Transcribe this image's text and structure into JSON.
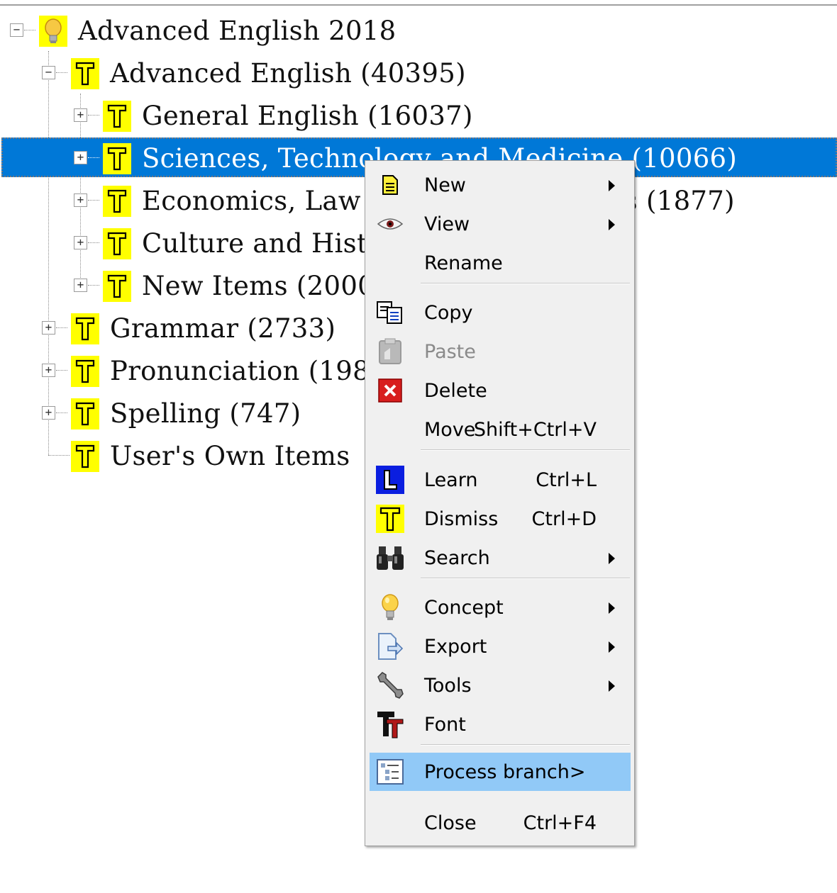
{
  "tree": {
    "root": {
      "label": "Advanced English 2018",
      "expander": "−"
    },
    "nodes": [
      {
        "label": "Advanced English (40395)",
        "expander": "−"
      },
      {
        "label": "General English (16037)",
        "expander": "+"
      },
      {
        "label": "Sciences, Technology and Medicine (10066)",
        "expander": "+"
      },
      {
        "label": "Economics, Law and Social Sciences (1877)",
        "expander": "+"
      },
      {
        "label": "Culture and History (10415)",
        "expander": "+"
      },
      {
        "label": "New Items (2000)",
        "expander": "+"
      },
      {
        "label": "Grammar (2733)",
        "expander": "+"
      },
      {
        "label": "Pronunciation (1981)",
        "expander": "+"
      },
      {
        "label": "Spelling (747)",
        "expander": "+"
      },
      {
        "label": "User's Own Items"
      }
    ]
  },
  "menu": {
    "items": [
      {
        "label": "New",
        "icon": "new-document-icon",
        "submenu": true
      },
      {
        "label": "View",
        "icon": "eye-icon",
        "submenu": true
      },
      {
        "label": "Rename"
      },
      {
        "label": "Copy",
        "icon": "copy-icon"
      },
      {
        "label": "Paste",
        "icon": "paste-icon",
        "disabled": true
      },
      {
        "label": "Delete",
        "icon": "delete-icon"
      },
      {
        "label": "Move",
        "shortcut": "Shift+Ctrl+V"
      },
      {
        "label": "Learn",
        "icon": "learn-icon",
        "shortcut": "Ctrl+L"
      },
      {
        "label": "Dismiss",
        "icon": "dismiss-icon",
        "shortcut": "Ctrl+D"
      },
      {
        "label": "Search",
        "icon": "binoculars-icon",
        "submenu": true
      },
      {
        "label": "Concept",
        "icon": "lightbulb-icon",
        "submenu": true
      },
      {
        "label": "Export",
        "icon": "export-icon",
        "submenu": true
      },
      {
        "label": "Tools",
        "icon": "wrench-icon",
        "submenu": true
      },
      {
        "label": "Font",
        "icon": "font-icon"
      },
      {
        "label": "Process branch>",
        "icon": "process-branch-icon",
        "highlighted": true
      },
      {
        "label": "Close",
        "shortcut": "Ctrl+F4"
      }
    ]
  },
  "colors": {
    "selection": "#0078d7",
    "topic_icon_bg": "#ffff00",
    "menu_bg": "#f0f0f0",
    "menu_highlight": "#91c9f7"
  }
}
